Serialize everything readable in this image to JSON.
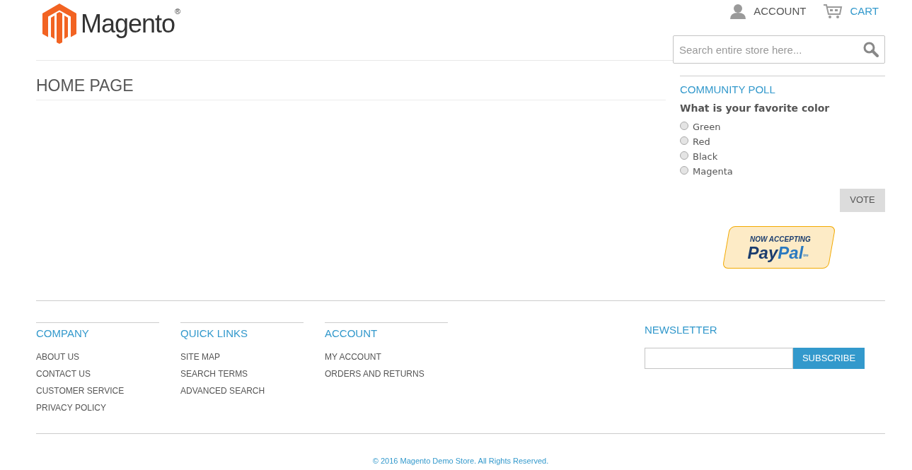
{
  "header": {
    "logo": {
      "text": "Magento",
      "mark": "®"
    },
    "links": [
      {
        "kind": "account",
        "label": "ACCOUNT"
      },
      {
        "kind": "cart",
        "label": "CART"
      }
    ],
    "search": {
      "placeholder": "Search entire store here..."
    }
  },
  "page_title": "HOME PAGE",
  "poll": {
    "title": "COMMUNITY POLL",
    "question": "What is your favorite color",
    "options": [
      {
        "label": "Green",
        "selected": false
      },
      {
        "label": "Red",
        "selected": false
      },
      {
        "label": "Black",
        "selected": false
      },
      {
        "label": "Magenta",
        "selected": false
      }
    ],
    "button": "VOTE"
  },
  "paypal": {
    "line1": "NOW ACCEPTING",
    "pay": "Pay",
    "pal": "Pal",
    "tm": "tm"
  },
  "footer": {
    "columns": [
      {
        "title": "COMPANY",
        "links": [
          "ABOUT US",
          "CONTACT US",
          "CUSTOMER SERVICE",
          "PRIVACY POLICY"
        ]
      },
      {
        "title": "QUICK LINKS",
        "links": [
          "SITE MAP",
          "SEARCH TERMS",
          "ADVANCED SEARCH"
        ]
      },
      {
        "title": "ACCOUNT",
        "links": [
          "MY ACCOUNT",
          "ORDERS AND RETURNS"
        ]
      }
    ],
    "newsletter": {
      "title": "NEWSLETTER",
      "button": "SUBSCRIBE"
    },
    "copyright": "© 2016 Magento Demo Store. All Rights Reserved."
  }
}
